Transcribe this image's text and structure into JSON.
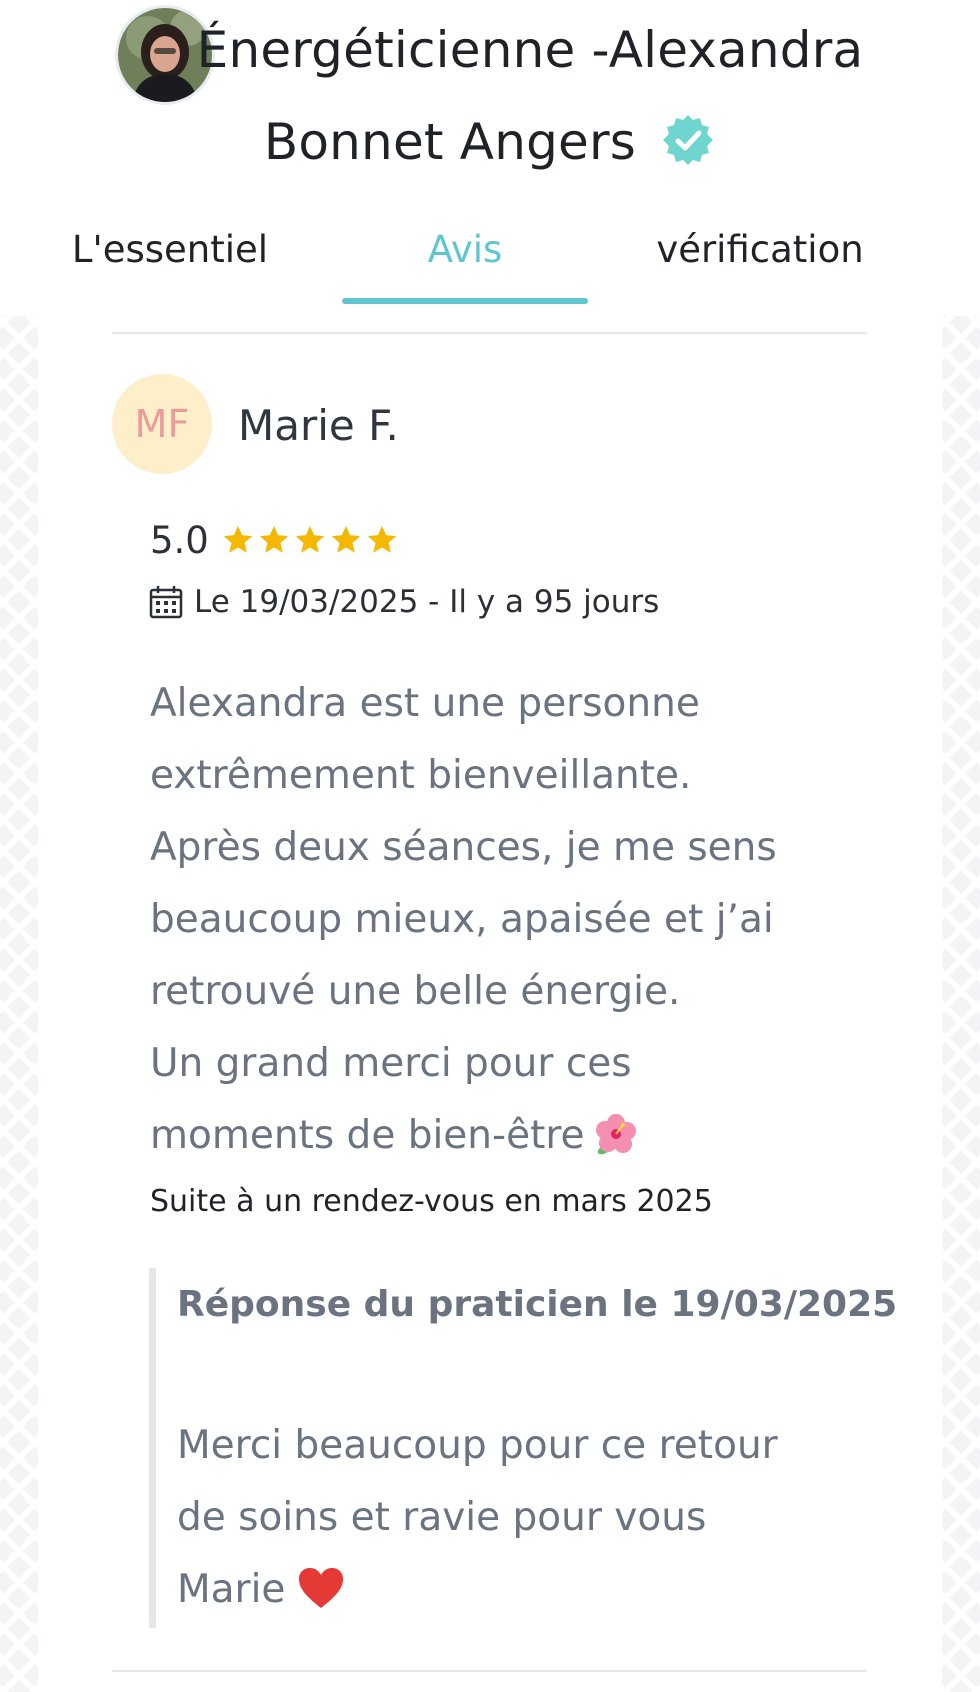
{
  "header": {
    "title_line1": "Énergéticienne -Alexandra",
    "title_line2": "Bonnet Angers",
    "verified_icon": "verified-badge-icon",
    "accent_color": "#5fc6cf"
  },
  "tabs": [
    {
      "label": "L'essentiel",
      "active": false
    },
    {
      "label": "Avis",
      "active": true
    },
    {
      "label": "vérification",
      "active": false
    }
  ],
  "review": {
    "initials": "MF",
    "author": "Marie F.",
    "rating": "5.0",
    "stars": 5,
    "date_text": "Le 19/03/2025 - Il y a 95 jours",
    "text_lines": [
      "Alexandra est une personne",
      "extrêmement bienveillante.",
      "Après deux séances, je me sens",
      "beaucoup mieux, apaisée et j’ai",
      "retrouvé une belle énergie.",
      "Un grand merci pour ces",
      "moments de bien-être"
    ],
    "visit_note": "Suite à un rendez-vous en mars 2025",
    "reply": {
      "title": "Réponse du praticien le 19/03/2025",
      "text_lines": [
        "Merci beaucoup pour ce retour",
        "de soins et ravie pour vous",
        "Marie"
      ]
    }
  }
}
